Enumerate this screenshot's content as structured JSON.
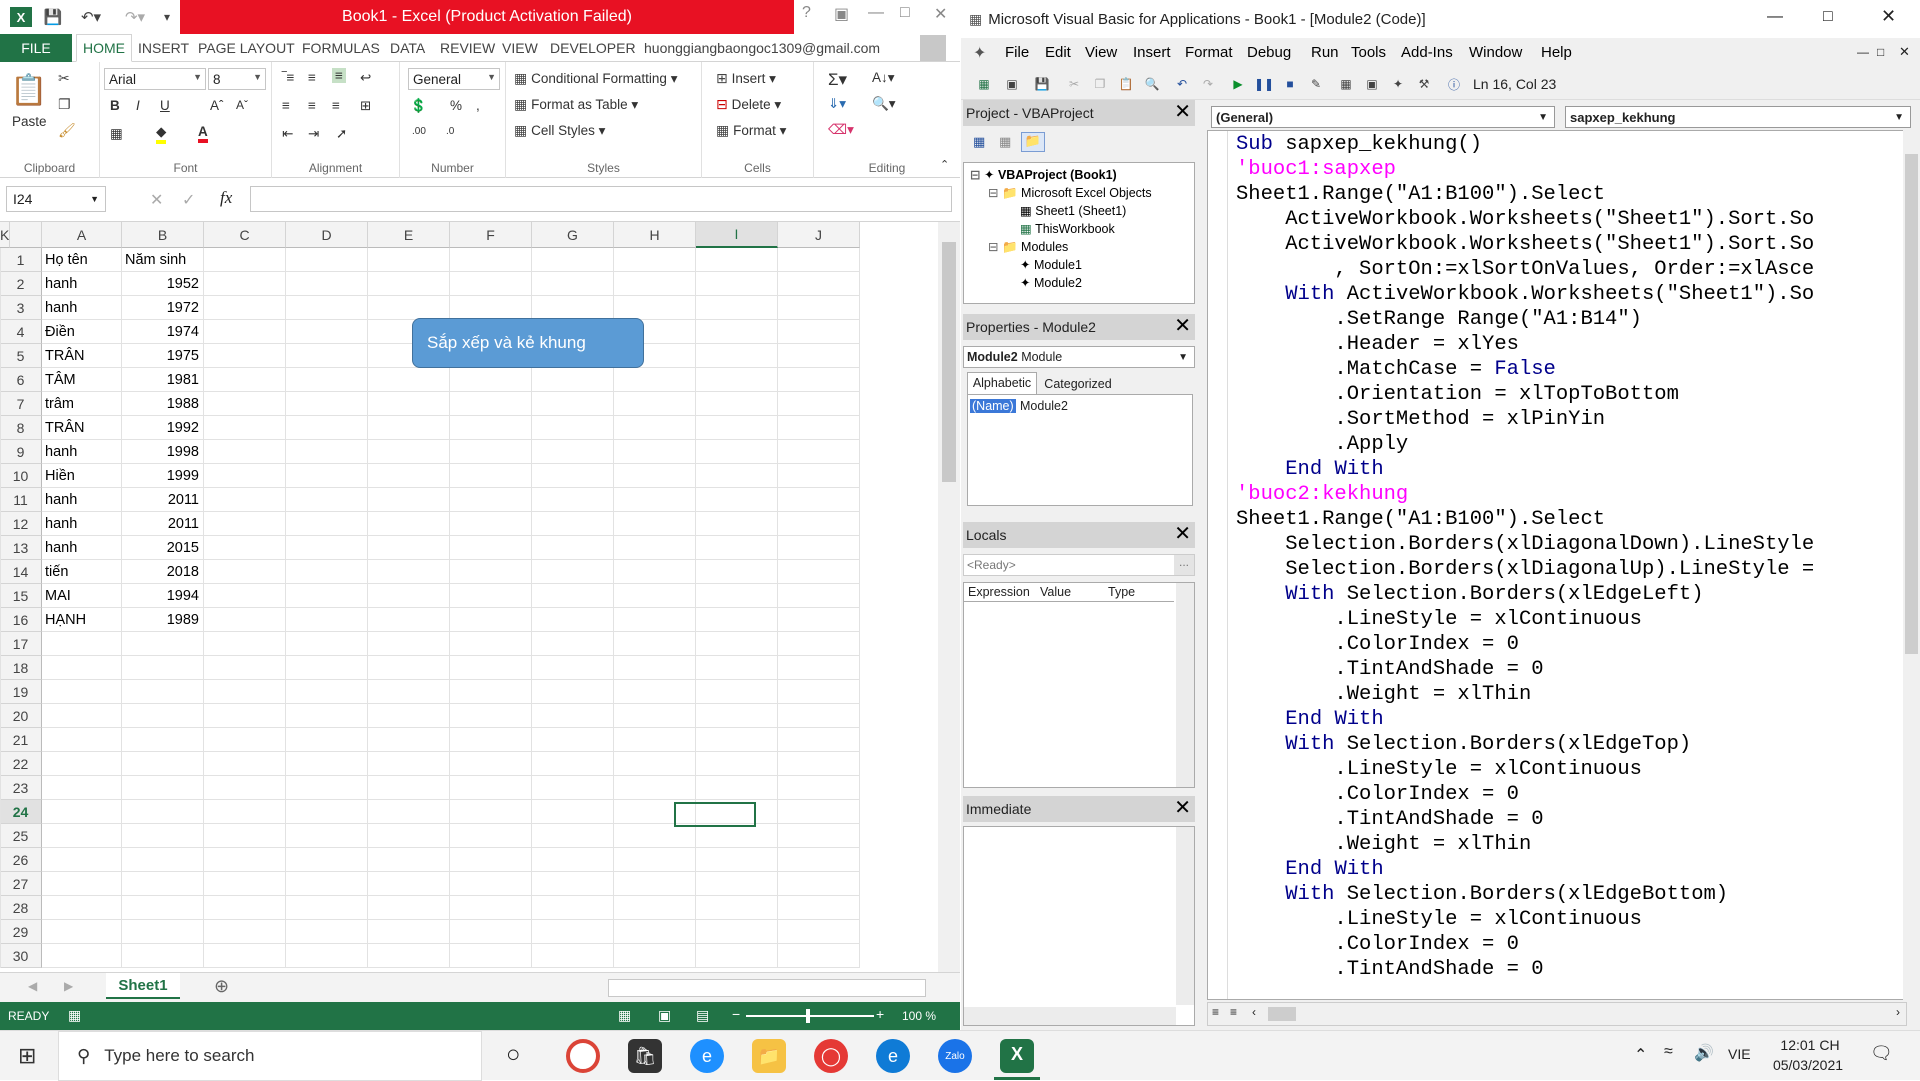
{
  "excel": {
    "title": "Book1  -  Excel (Product Activation Failed)",
    "logo": "X",
    "tabs": {
      "file": "FILE",
      "home": "HOME",
      "insert": "INSERT",
      "page_layout": "PAGE LAYOUT",
      "formulas": "FORMULAS",
      "data": "DATA",
      "review": "REVIEW",
      "view": "VIEW",
      "developer": "DEVELOPER"
    },
    "account": "huonggiangbaongoc1309@gmail.com",
    "ribbon": {
      "paste": "Paste",
      "clipboard": "Clipboard",
      "font_name": "Arial",
      "font_size": "8",
      "font": "Font",
      "alignment": "Alignment",
      "number_format": "General",
      "number": "Number",
      "conditional_formatting": "Conditional Formatting",
      "format_as_table": "Format as Table",
      "cell_styles": "Cell Styles",
      "styles": "Styles",
      "insert": "Insert",
      "delete": "Delete",
      "format": "Format",
      "cells": "Cells",
      "editing": "Editing"
    },
    "name_box": "I24",
    "fx": "fx",
    "columns": [
      "A",
      "B",
      "C",
      "D",
      "E",
      "F",
      "G",
      "H",
      "I",
      "J",
      "K"
    ],
    "rows": [
      "1",
      "2",
      "3",
      "4",
      "5",
      "6",
      "7",
      "8",
      "9",
      "10",
      "11",
      "12",
      "13",
      "14",
      "15",
      "16",
      "17",
      "18",
      "19",
      "20",
      "21",
      "22",
      "23",
      "24",
      "25",
      "26",
      "27",
      "28",
      "29",
      "30"
    ],
    "data": [
      [
        "Họ tên",
        "Năm sinh"
      ],
      [
        "hanh",
        "1952"
      ],
      [
        "hanh",
        "1972"
      ],
      [
        "Điền",
        "1974"
      ],
      [
        "TRÂN",
        "1975"
      ],
      [
        "TÂM",
        "1981"
      ],
      [
        "trâm",
        "1988"
      ],
      [
        "TRÂN",
        "1992"
      ],
      [
        "hanh",
        "1998"
      ],
      [
        "Hiền",
        "1999"
      ],
      [
        "hanh",
        "2011"
      ],
      [
        "hanh",
        "2011"
      ],
      [
        "hanh",
        "2015"
      ],
      [
        "tiến",
        "2018"
      ],
      [
        "MAI",
        "1994"
      ],
      [
        "HẠNH",
        "1989"
      ]
    ],
    "macro_button": "Sắp xếp và kẻ khung",
    "sheet_tab": "Sheet1",
    "status": "READY",
    "zoom": "100 %"
  },
  "vba": {
    "title": "Microsoft Visual Basic for Applications - Book1 - [Module2 (Code)]",
    "menu": [
      "File",
      "Edit",
      "View",
      "Insert",
      "Format",
      "Debug",
      "Run",
      "Tools",
      "Add-Ins",
      "Window",
      "Help"
    ],
    "cursor_pos": "Ln 16, Col 23",
    "project": {
      "header": "Project - VBAProject",
      "root": "VBAProject (Book1)",
      "excel_objects": "Microsoft Excel Objects",
      "sheet1": "Sheet1 (Sheet1)",
      "thisworkbook": "ThisWorkbook",
      "modules": "Modules",
      "module1": "Module1",
      "module2": "Module2"
    },
    "properties": {
      "header": "Properties - Module2",
      "object": "Module2",
      "object_type": "Module",
      "tab_alpha": "Alphabetic",
      "tab_cat": "Categorized",
      "name_key": "(Name)",
      "name_val": "Module2"
    },
    "locals": {
      "header": "Locals",
      "ready": "<Ready>",
      "col_expr": "Expression",
      "col_value": "Value",
      "col_type": "Type"
    },
    "immediate": {
      "header": "Immediate"
    },
    "general_drop": "(General)",
    "proc_drop": "sapxep_kekhung",
    "code": [
      "Sub sapxep_kekhung()",
      "'buoc1:sapxep",
      "Sheet1.Range(\"A1:B100\").Select",
      "    ActiveWorkbook.Worksheets(\"Sheet1\").Sort.So",
      "    ActiveWorkbook.Worksheets(\"Sheet1\").Sort.So",
      "        , SortOn:=xlSortOnValues, Order:=xlAsce",
      "    With ActiveWorkbook.Worksheets(\"Sheet1\").So",
      "        .SetRange Range(\"A1:B14\")",
      "        .Header = xlYes",
      "        .MatchCase = False",
      "        .Orientation = xlTopToBottom",
      "        .SortMethod = xlPinYin",
      "        .Apply",
      "    End With",
      "'buoc2:kekhung",
      "Sheet1.Range(\"A1:B100\").Select",
      "    Selection.Borders(xlDiagonalDown).LineStyle",
      "    Selection.Borders(xlDiagonalUp).LineStyle =",
      "    With Selection.Borders(xlEdgeLeft)",
      "        .LineStyle = xlContinuous",
      "        .ColorIndex = 0",
      "        .TintAndShade = 0",
      "        .Weight = xlThin",
      "    End With",
      "    With Selection.Borders(xlEdgeTop)",
      "        .LineStyle = xlContinuous",
      "        .ColorIndex = 0",
      "        .TintAndShade = 0",
      "        .Weight = xlThin",
      "    End With",
      "    With Selection.Borders(xlEdgeBottom)",
      "        .LineStyle = xlContinuous",
      "        .ColorIndex = 0",
      "        .TintAndShade = 0"
    ]
  },
  "taskbar": {
    "search_placeholder": "Type here to search",
    "lang": "VIE",
    "time": "12:01 CH",
    "date": "05/03/2021"
  }
}
